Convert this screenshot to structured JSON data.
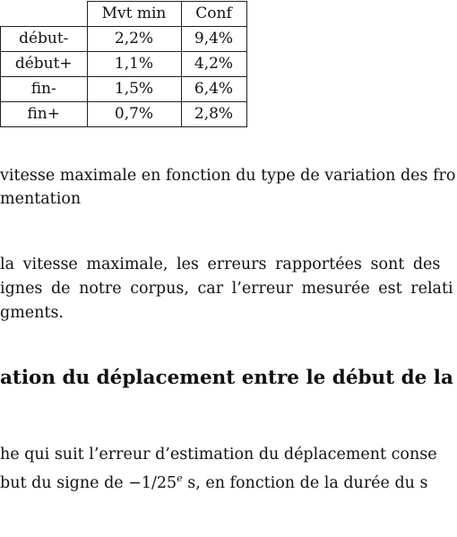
{
  "table": {
    "headers": [
      "",
      "Mvt min",
      "Conf"
    ],
    "rows": [
      {
        "label": "début-",
        "mvt_min": "2,2%",
        "conf": "9,4%"
      },
      {
        "label": "début+",
        "mvt_min": "1,1%",
        "conf": "4,2%"
      },
      {
        "label": "fin-",
        "mvt_min": "1,5%",
        "conf": "6,4%"
      },
      {
        "label": "fin+",
        "mvt_min": "0,7%",
        "conf": "2,8%"
      }
    ]
  },
  "caption": {
    "line1": "vitesse maximale en fonction du type de variation des fro",
    "line2": "mentation"
  },
  "paragraph1": {
    "line1": "la vitesse maximale, les erreurs rapportées sont des",
    "line2": "ignes de notre corpus, car l’erreur mesurée est relati",
    "line3": "gments."
  },
  "heading": "ation du déplacement entre le début de la r",
  "paragraph2": {
    "line1": "he qui suit l’erreur d’estimation du déplacement conse",
    "line2_pre": "but du signe de −1/25",
    "line2_sup": "e",
    "line2_post": " s, en fonction de la durée du s"
  }
}
